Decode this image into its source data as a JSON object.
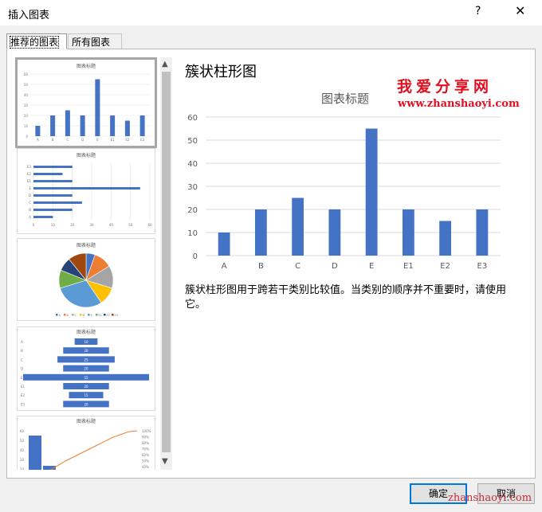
{
  "window": {
    "title": "插入图表",
    "help": "?",
    "close": "✕"
  },
  "tabs": [
    {
      "label": "推荐的图表"
    },
    {
      "label": "所有图表"
    }
  ],
  "thumbnails": {
    "title": "图表标题",
    "bar": {
      "categories": [
        "A",
        "B",
        "C",
        "D",
        "E",
        "E1",
        "E2",
        "E3"
      ],
      "values": [
        10,
        20,
        25,
        20,
        55,
        20,
        15,
        20
      ],
      "y_ticks": [
        "0",
        "10",
        "20",
        "30",
        "40",
        "50",
        "60"
      ]
    },
    "hbar": {
      "categories": [
        "E3",
        "E2",
        "E1",
        "E",
        "D",
        "C",
        "B",
        "A"
      ],
      "values": [
        20,
        15,
        20,
        55,
        20,
        25,
        20,
        10
      ],
      "x_ticks": [
        "0",
        "10",
        "20",
        "30",
        "40",
        "50",
        "60"
      ]
    },
    "pie": {
      "values": [
        10,
        20,
        25,
        20,
        55,
        20,
        15,
        20
      ],
      "colors": [
        "#4472c4",
        "#ed7d31",
        "#a5a5a5",
        "#ffc000",
        "#5b9bd5",
        "#70ad47",
        "#264478",
        "#9e480e"
      ],
      "legend": [
        "A",
        "B",
        "C",
        "D",
        "E",
        "E1",
        "E2",
        "E3"
      ]
    },
    "funnel": {
      "categories": [
        "A",
        "B",
        "C",
        "D",
        "E",
        "E1",
        "E2",
        "E3"
      ],
      "values": [
        10,
        20,
        25,
        20,
        55,
        20,
        15,
        20
      ],
      "labels": [
        "10",
        "20",
        "25",
        "20",
        "55",
        "20",
        "15",
        "20"
      ]
    },
    "pareto": {
      "y_ticks": [
        "60",
        "50",
        "40",
        "30",
        "20"
      ],
      "y2_ticks": [
        "100%",
        "90%",
        "80%",
        "70%",
        "60%",
        "50%",
        "40%"
      ]
    }
  },
  "preview": {
    "heading": "簇状柱形图",
    "description": "簇状柱形图用于跨若干类别比较值。当类别的顺序并不重要时，请使用它。"
  },
  "chart_data": {
    "type": "bar",
    "title": "图表标题",
    "categories": [
      "A",
      "B",
      "C",
      "D",
      "E",
      "E1",
      "E2",
      "E3"
    ],
    "values": [
      10,
      20,
      25,
      20,
      55,
      20,
      15,
      20
    ],
    "ylim": [
      0,
      60
    ],
    "y_ticks": [
      0,
      10,
      20,
      30,
      40,
      50,
      60
    ],
    "grid": true,
    "bar_color": "#4472c4"
  },
  "watermark": {
    "cn": "我爱分享网",
    "url": "www.zhanshaoyi.com",
    "footer": "zhanshaoyi.com"
  },
  "buttons": {
    "ok": "确定",
    "cancel": "取消"
  }
}
